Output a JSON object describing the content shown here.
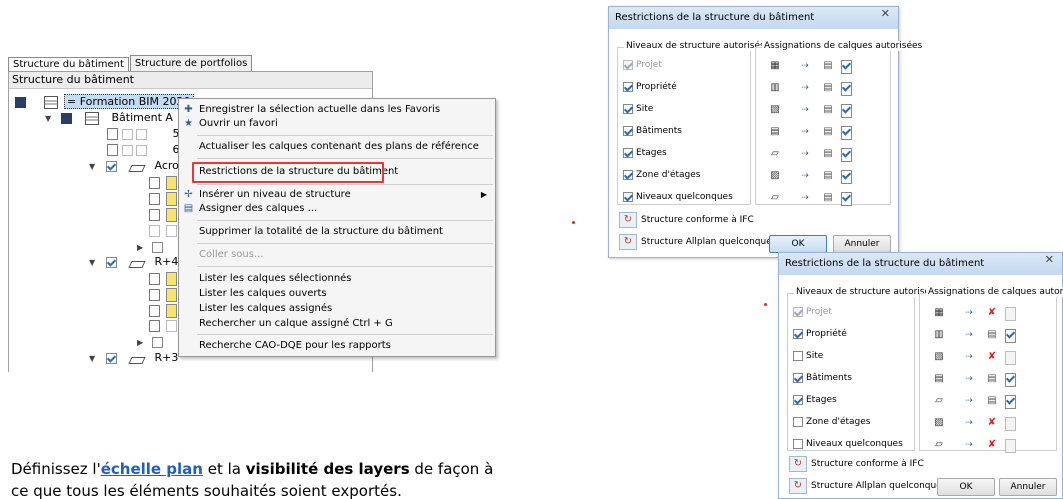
{
  "tabs": [
    "Structure du bâtiment",
    "Structure de portfolios"
  ],
  "tree": {
    "header": "Structure du bâtiment",
    "root_label": "= Formation BIM 2020",
    "building_label": "Bâtiment A",
    "num_5": "5",
    "num_6": "6",
    "acro_label": "Acro",
    "r4_label": "R+4",
    "r3_label": "R+3"
  },
  "context_menu": {
    "items": [
      {
        "label": "Enregistrer la sélection actuelle dans les Favoris",
        "icon": "favorites-save-icon"
      },
      {
        "label": "Ouvrir un favori",
        "icon": "favorites-open-icon"
      },
      {
        "label": "Actualiser les calques contenant des plans de référence"
      },
      {
        "label": "Restrictions de la structure du bâtiment"
      },
      {
        "label": "Insérer un niveau de structure",
        "icon": "insert-level-icon"
      },
      {
        "label": "Assigner des calques ...",
        "icon": "assign-layers-icon"
      },
      {
        "label": "Supprimer la totalité de la structure du bâtiment"
      },
      {
        "label": "Coller sous..."
      },
      {
        "label": "Lister les calques sélectionnés"
      },
      {
        "label": "Lister les calques ouverts"
      },
      {
        "label": "Lister les calques assignés"
      },
      {
        "label": "Rechercher un calque assigné Ctrl + G"
      },
      {
        "label": "Recherche CAO-DQE pour les rapports"
      }
    ]
  },
  "dialog1": {
    "title": "Restrictions de la structure du bâtiment",
    "group_levels": "Niveaux de structure autorisés",
    "group_assign": "Assignations de calques autorisées",
    "levels": [
      "Projet",
      "Propriété",
      "Site",
      "Bâtiments",
      "Etages",
      "Zone d'étages",
      "Niveaux quelconques"
    ],
    "btn_ifc": "Structure conforme à IFC",
    "btn_allplan": "Structure Allplan quelconque",
    "ok": "OK",
    "cancel": "Annuler"
  },
  "dialog2": {
    "title": "Restrictions de la structure du bâtiment",
    "group_levels": "Niveaux de structure autorisés",
    "group_assign": "Assignations de calques autorisées",
    "levels": [
      "Projet",
      "Propriété",
      "Site",
      "Bâtiments",
      "Etages",
      "Zone d'étages",
      "Niveaux quelconques"
    ],
    "btn_ifc": "Structure conforme à IFC",
    "btn_allplan": "Structure Allplan quelconque",
    "ok": "OK",
    "cancel": "Annuler"
  },
  "body_text": {
    "prefix": "Définissez l'",
    "link": "échelle plan",
    "middle": " et la ",
    "bold": "visibilité des layers",
    "suffix": " de façon à",
    "line2": "ce que tous les éléments souhaités soient exportés."
  },
  "colors": {
    "highlight_border": "#e53935",
    "link": "#1d5fc2",
    "title_bar": "#c4d8f0"
  }
}
